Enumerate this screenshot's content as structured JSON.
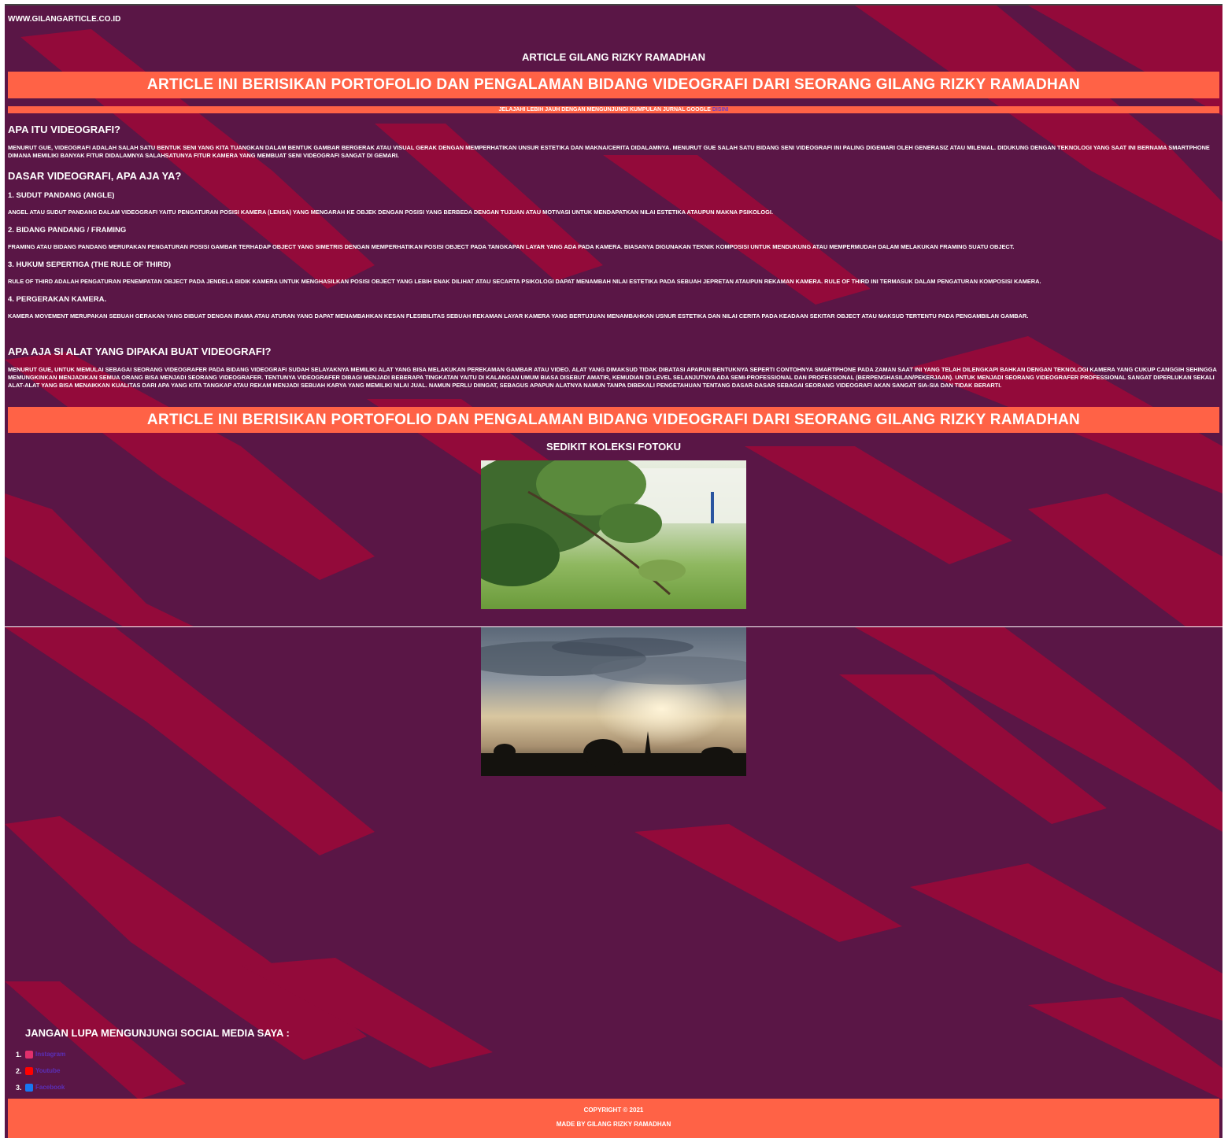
{
  "header": {
    "site_url": "www.gilangarticle.co.id",
    "article_title": "Article Gilang Rizky Ramadhan"
  },
  "banner": {
    "text": "Article Ini Berisikan Portofolio dan Pengalaman Bidang Videografi Dari Seorang Gilang Rizky Ramadhan"
  },
  "explore": {
    "text": "Jelajahi lebih jauh dengan mengunjungi kumpulan jurnal google",
    "link_label": "DISINI"
  },
  "sections": {
    "what_is": {
      "heading": "Apa Itu Videografi?",
      "body": "Menurut gue, videografi adalah salah satu bentuk seni yang kita tuangkan dalam bentuk gambar bergerak atau visual gerak dengan memperhatikan unsur estetika dan makna/cerita didalamnya. Menurut gue salah satu bidang seni videografi ini paling digemari oleh generasiZ atau milenial. Didukung dengan teknologi yang saat ini bernama smartphone dimana memiliki banyak fitur didalamnya salahsatunya fitur kamera yang membuat seni videografi sangat di gemari."
    },
    "basics": {
      "heading": "Dasar Videografi, Apa Aja Ya?",
      "items": [
        {
          "title": "1. Sudut Pandang (Angle)",
          "body": "Angel atau sudut pandang dalam videografi yaitu pengaturan posisi kamera (lensa) yang mengarah ke objek dengan posisi yang berbeda dengan tujuan atau motivasi untuk mendapatkan nilai estetika ataupun makna psikologi."
        },
        {
          "title": "2. Bidang Pandang / Framing",
          "body": "Framing atau bidang pandang merupakan pengaturan posisi gambar terhadap object yang simetris dengan memperhatikan posisi object pada tangkapan layar yang ada pada kamera. Biasanya digunakan teknik komposisi untuk mendukung atau mempermudah dalam melakukan framing suatu object."
        },
        {
          "title": "3. Hukum Sepertiga (The Rule of Third)",
          "body": "Rule of third adalah pengaturan penempatan object pada jendela bidik kamera untuk menghasilkan posisi object yang lebih enak dilihat atau secarta psikologi dapat menambah nilai estetika pada sebuah jepretan ataupun rekaman kamera. Rule of third ini termasuk dalam pengaturan komposisi kamera."
        },
        {
          "title": "4. Pergerakan Kamera.",
          "body": "Kamera movement merupakan sebuah gerakan yang dibuat dengan irama atau aturan yang dapat menambahkan kesan flesibilitas sebuah rekaman layar kamera yang bertujuan menambahkan usnur estetika dan nilai cerita pada keadaan sekitar object atau maksud tertentu pada pengambilan gambar."
        }
      ]
    },
    "tools": {
      "heading": "Apa Aja Si Alat yang dipakai Buat Videografi?",
      "body": "Menurut gue, untuk memulai sebagai seorang videografer pada bidang videografi sudah selayaknya memiliki alat yang bisa melakukan perekaman gambar atau video. Alat yang dimaksud tidak dibatasi apapun bentuknya seperti contohnya smartphone pada zaman saat ini yang telah dilengkapi bahkan dengan teknologi kamera yang cukup canggih sehingga memungkinkan menjadikan semua orang bisa menjadi seorang videografer. Tentunya videografer dibagi menjadi beberapa tingkatan yaitu di kalangan umum biasa disebut amatir, kemudian di level selanjutnya ada semi-professional dan professional (berpenghasilan/pekerjaan). Untuk menjadi seorang videografer professional sangat diperlukan sekali alat-alat yang bisa menaikkan kualitas dari apa yang kita tangkap atau rekam menjadi sebuah karya yang memiliki nilai jual. Namun perlu diingat, sebagus apapun alatnya namun tanpa dibekali pengetahuan tentang dasar-dasar sebagai seorang videografi akan sangat sia-sia dan tidak berarti."
    }
  },
  "gallery": {
    "title": "Sedikit Koleksi FotoKu"
  },
  "social": {
    "title": "Jangan Lupa Mengunjungi Social Media Saya :",
    "items": [
      {
        "num": "1.",
        "icon": "instagram-icon",
        "label": "Instagram",
        "color": "#e1306c"
      },
      {
        "num": "2.",
        "icon": "youtube-icon",
        "label": "Youtube",
        "color": "#ff0000"
      },
      {
        "num": "3.",
        "icon": "facebook-icon",
        "label": "Facebook",
        "color": "#1877f2"
      }
    ]
  },
  "footer": {
    "copyright": "Copyright © 2021",
    "made_by": "Made By Gilang Rizky Ramadhan"
  },
  "colors": {
    "background": "#5a1646",
    "stripe": "#930a3a",
    "accent": "#ff6246",
    "link": "#5b2fb8"
  }
}
